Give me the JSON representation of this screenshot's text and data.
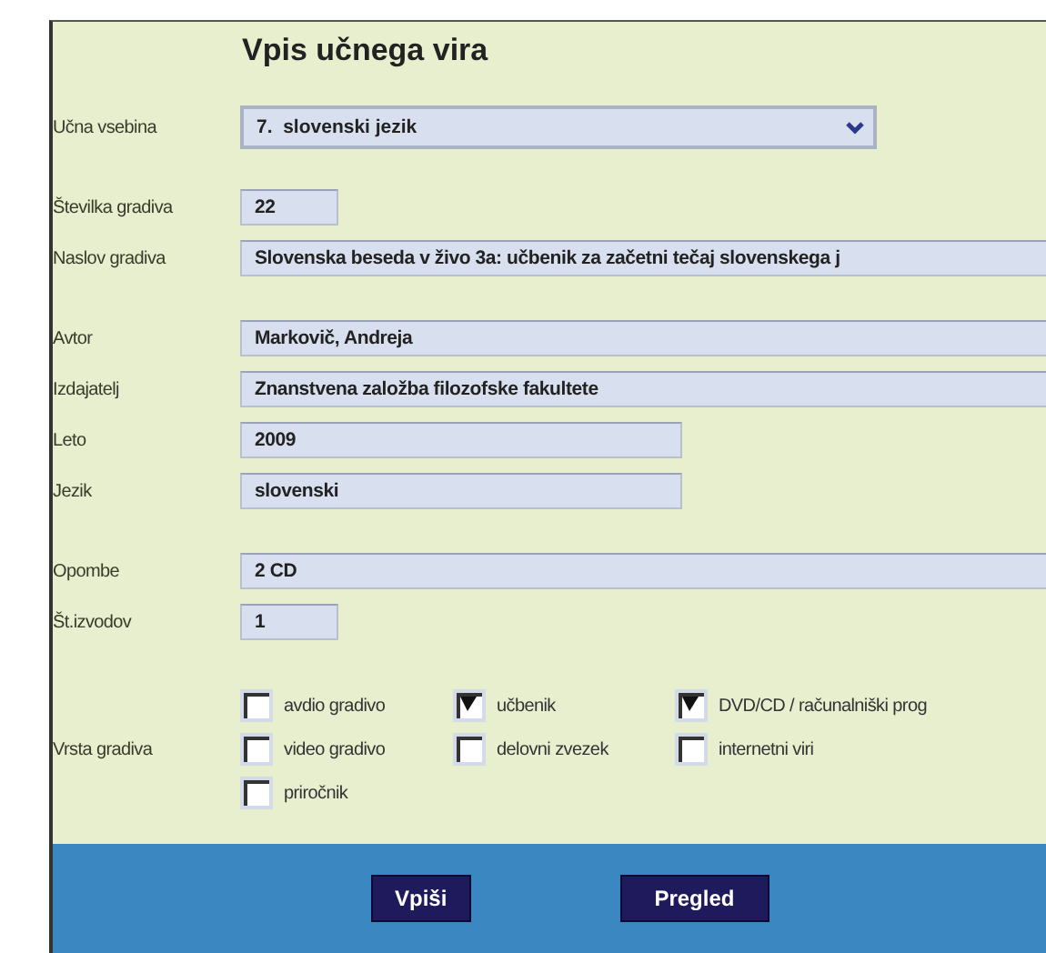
{
  "title": "Vpis učnega vira",
  "subject": {
    "label": "Učna vsebina",
    "value": "7.  slovenski jezik"
  },
  "fields": [
    {
      "label": "Številka gradiva",
      "value": "22"
    },
    {
      "label": "Naslov gradiva",
      "value": "Slovenska beseda v živo 3a: učbenik za začetni tečaj slovenskega j"
    },
    {
      "label": "Avtor",
      "value": "Markovič, Andreja"
    },
    {
      "label": "Izdajatelj",
      "value": "Znanstvena založba filozofske fakultete"
    },
    {
      "label": "Leto",
      "value": "2009"
    },
    {
      "label": "Jezik",
      "value": "slovenski"
    },
    {
      "label": "Opombe",
      "value": "2 CD"
    },
    {
      "label": "Št.izvodov",
      "value": "1"
    }
  ],
  "material_type": {
    "label": "Vrsta gradiva",
    "options": [
      {
        "label": "avdio gradivo",
        "checked": false
      },
      {
        "label": "učbenik",
        "checked": true
      },
      {
        "label": "DVD/CD / računalniški prog",
        "checked": true
      },
      {
        "label": "video gradivo",
        "checked": false
      },
      {
        "label": "delovni zvezek",
        "checked": false
      },
      {
        "label": "internetni viri",
        "checked": false
      },
      {
        "label": "priročnik",
        "checked": false
      }
    ]
  },
  "buttons": [
    "Vpiši",
    "Pregled"
  ]
}
